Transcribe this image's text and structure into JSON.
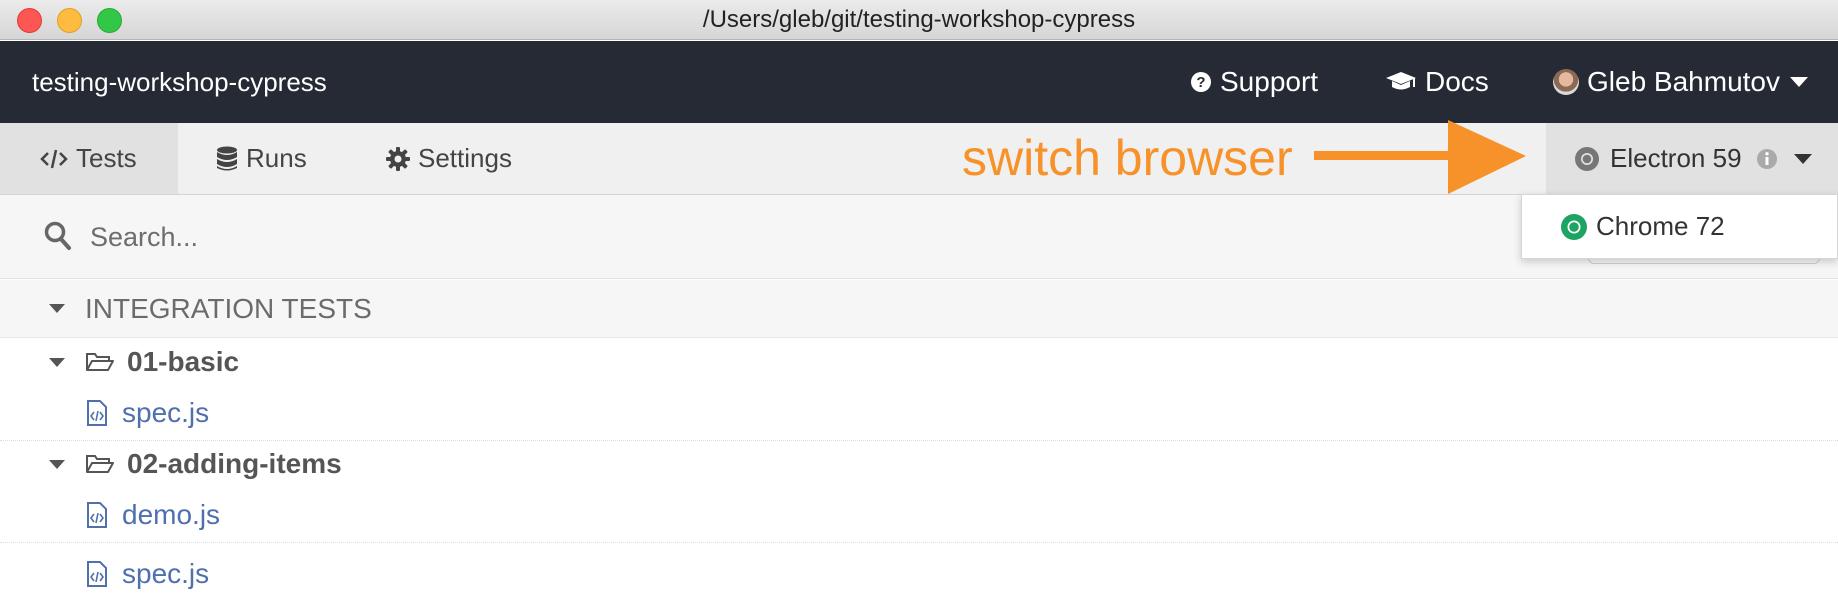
{
  "window": {
    "title": "/Users/gleb/git/testing-workshop-cypress"
  },
  "header": {
    "app_name": "testing-workshop-cypress",
    "support_label": "Support",
    "docs_label": "Docs",
    "user_name": "Gleb Bahmutov"
  },
  "tabs": {
    "tests_label": "Tests",
    "runs_label": "Runs",
    "settings_label": "Settings"
  },
  "annotation": {
    "text": "switch browser",
    "color": "#f7922a"
  },
  "browser": {
    "selected": "Electron 59",
    "options": [
      "Chrome 72"
    ]
  },
  "search": {
    "placeholder": "Search..."
  },
  "specs": {
    "section_label": "INTEGRATION TESTS",
    "folders": [
      {
        "name": "01-basic",
        "files": [
          "spec.js"
        ]
      },
      {
        "name": "02-adding-items",
        "files": [
          "demo.js",
          "spec.js"
        ]
      }
    ]
  },
  "colors": {
    "header_bg": "#262a35",
    "link": "#4f6fad",
    "chrome_green": "#1da462"
  }
}
